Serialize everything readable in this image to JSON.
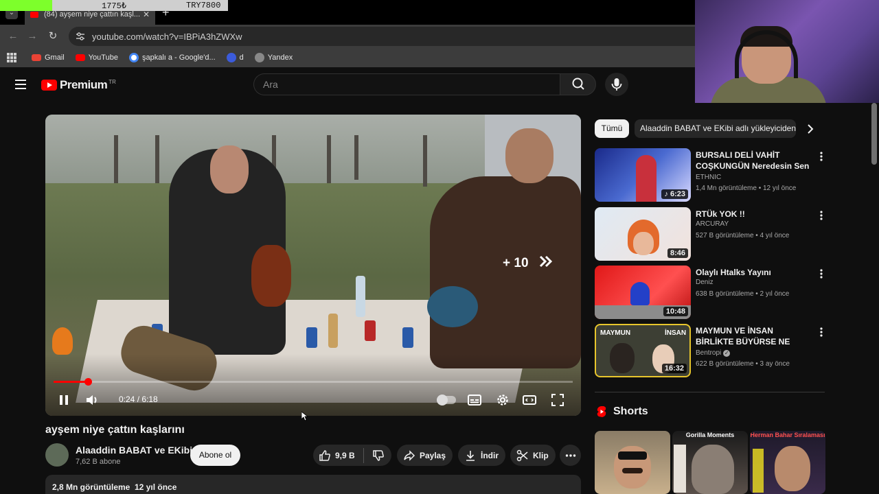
{
  "overlay": {
    "counter_left": "1775₺",
    "counter_right": "TRY7800"
  },
  "browser": {
    "tab_title": "(84) ayşem niye çattın kaşl...",
    "url": "youtube.com/watch?v=IBPiA3hZWXw",
    "bookmarks": [
      "Gmail",
      "YouTube",
      "şapkalı a - Google'd...",
      "d",
      "Yandex"
    ]
  },
  "header": {
    "logo": "Premium",
    "region": "TR",
    "search_placeholder": "Ara"
  },
  "player": {
    "seek_badge": "+ 10",
    "time": "0:24 / 6:18",
    "progress": 0.066
  },
  "video": {
    "title": "ayşem niye çattın kaşlarını",
    "channel": "Alaaddin BABAT ve EKibi",
    "subscribers": "7,62 B abone",
    "subscribe_label": "Abone ol",
    "likes": "9,9 B",
    "share_label": "Paylaş",
    "download_label": "İndir",
    "clip_label": "Klip",
    "views_date": "2,8 Mn görüntüleme  12 yıl önce"
  },
  "sidebar": {
    "chips": [
      "Tümü",
      "Alaaddin BABAT ve EKibi adlı yükleyiciden"
    ],
    "recommendations": [
      {
        "title": "BURSALI DELİ VAHİT COŞKUNGÜN Neredesin Sen ...",
        "channel": "ETHNIC",
        "meta": "1,4 Mn görüntüleme • 12 yıl önce",
        "duration": "6:23",
        "verified": false
      },
      {
        "title": "RTÜk YOK !!",
        "channel": "ARCURAY",
        "meta": "527 B görüntüleme • 4 yıl önce",
        "duration": "8:46",
        "verified": false
      },
      {
        "title": "Olaylı Htalks Yayını",
        "channel": "Deniz",
        "meta": "638 B görüntüleme • 2 yıl önce",
        "duration": "10:48",
        "verified": false
      },
      {
        "title": "MAYMUN VE İNSAN BİRLİKTE BÜYÜRSE NE OLUR?",
        "channel": "Bentropi",
        "meta": "622 B görüntüleme • 3 ay önce",
        "duration": "16:32",
        "verified": true
      }
    ],
    "thumb4_left": "MAYMUN",
    "thumb4_right": "İNSAN",
    "shorts_title": "Shorts",
    "shorts": [
      {
        "label": ""
      },
      {
        "label": "Gorilla Moments"
      },
      {
        "label": "Herman Bahar Sıralaması"
      }
    ]
  },
  "colors": {
    "brand": "#ff0000",
    "background": "#0f0f0f",
    "overlay_green": "#7dff2b"
  }
}
